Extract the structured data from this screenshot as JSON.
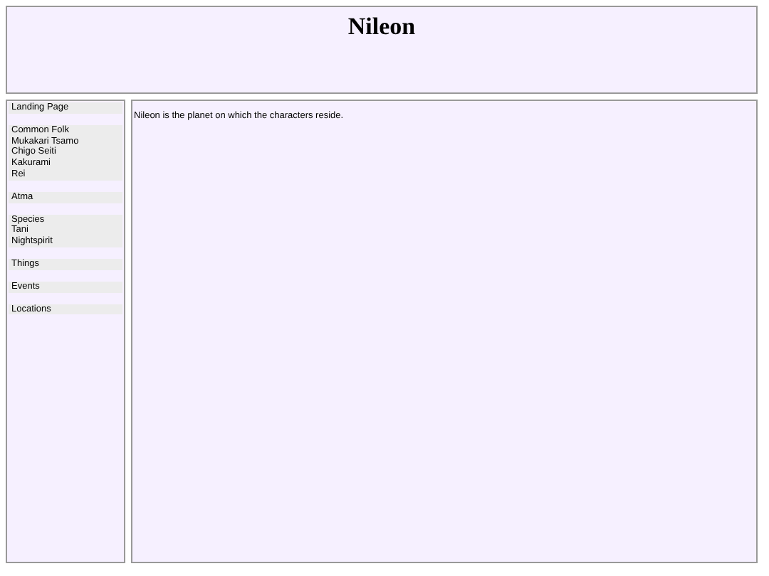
{
  "header": {
    "title": "Nileon"
  },
  "sidebar": {
    "groups": [
      {
        "items": [
          "Landing Page"
        ]
      },
      {
        "items": [
          "Common Folk",
          "Mukakari Tsamo",
          "Chigo Seiti",
          "Kakurami",
          "Rei"
        ]
      },
      {
        "items": [
          "Atma"
        ]
      },
      {
        "items": [
          "Species",
          "Tani",
          "Nightspirit"
        ]
      },
      {
        "items": [
          "Things"
        ]
      },
      {
        "items": [
          "Events"
        ]
      },
      {
        "items": [
          "Locations"
        ]
      }
    ]
  },
  "content": {
    "text": "Nileon is the planet on which the characters reside."
  }
}
